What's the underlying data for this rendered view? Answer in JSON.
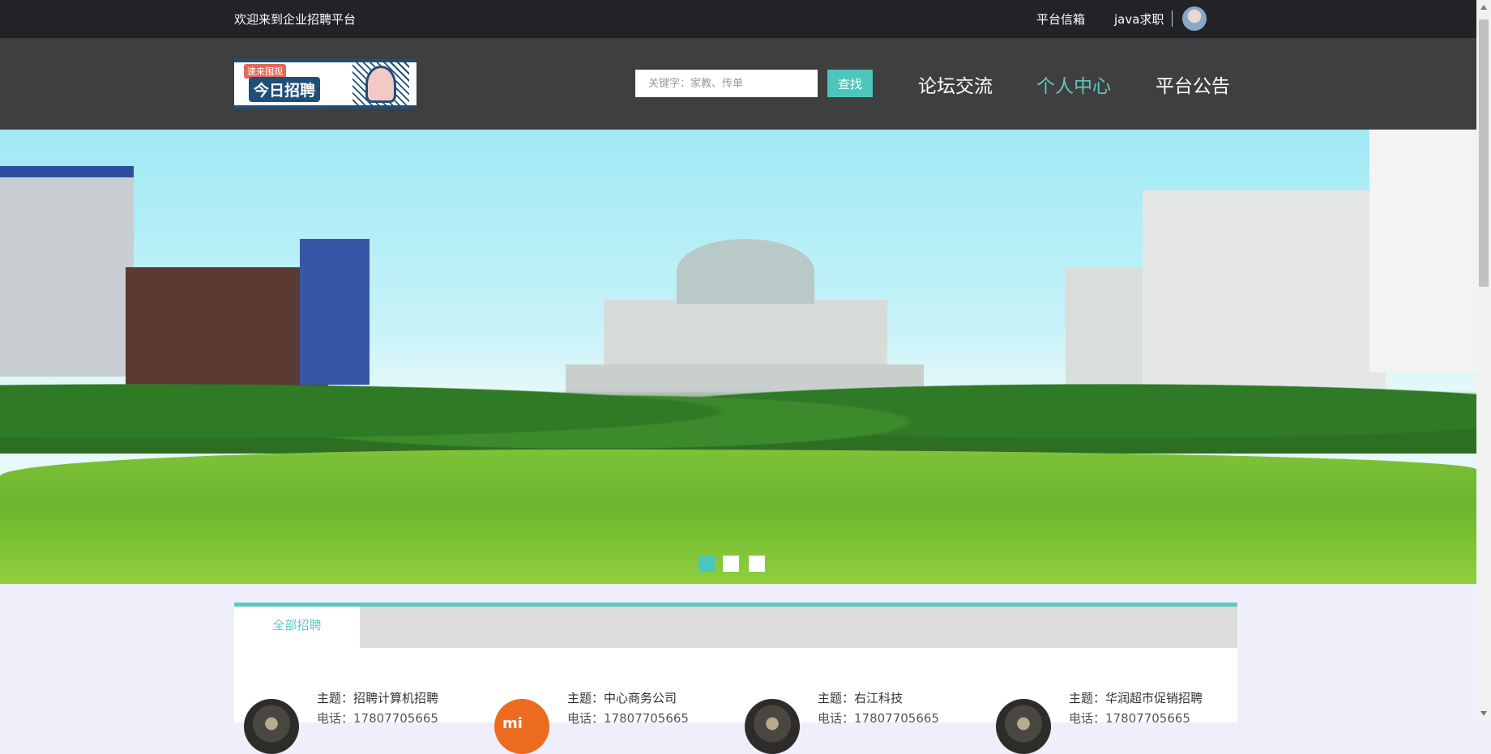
{
  "topbar": {
    "welcome": "欢迎来到企业招聘平台",
    "mailbox": "平台信箱",
    "username": "java求职"
  },
  "logo": {
    "tag": "速来围观",
    "title": "今日招聘"
  },
  "search": {
    "placeholder": "关键字：家教、传单",
    "button": "查找"
  },
  "nav": [
    {
      "label": "论坛交流",
      "active": false
    },
    {
      "label": "个人中心",
      "active": true
    },
    {
      "label": "平台公告",
      "active": false
    }
  ],
  "banner": {
    "slides": 3,
    "active_slide": 1
  },
  "tabs": [
    {
      "label": "全部招聘",
      "active": true
    }
  ],
  "jobs": [
    {
      "subject": "主题：招聘计算机招聘",
      "phone": "电话：17807705665"
    },
    {
      "subject": "主题：中心商务公司",
      "phone": "电话：17807705665"
    },
    {
      "subject": "主题：右江科技",
      "phone": "电话：17807705665"
    },
    {
      "subject": "主题：华润超市促销招聘",
      "phone": "电话：17807705665"
    }
  ],
  "colors": {
    "accent": "#4cc5bd",
    "topbar": "#212327",
    "header": "#3f3f3f"
  }
}
